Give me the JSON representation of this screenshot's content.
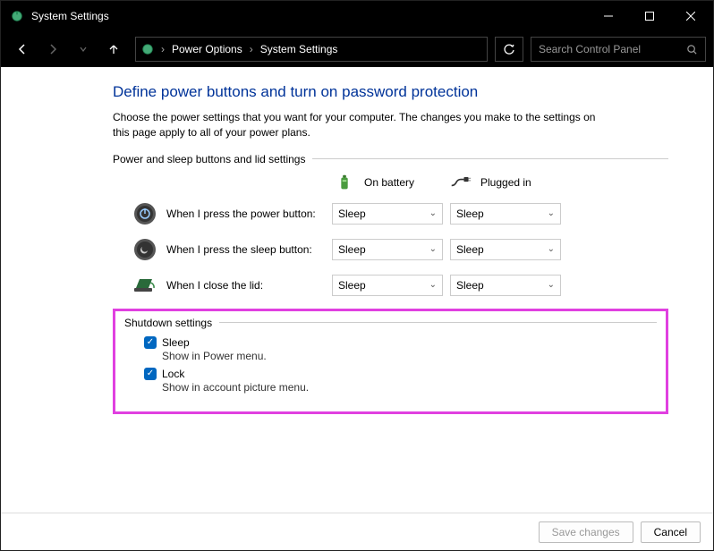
{
  "window": {
    "title": "System Settings"
  },
  "breadcrumb": {
    "item1": "Power Options",
    "item2": "System Settings"
  },
  "search": {
    "placeholder": "Search Control Panel"
  },
  "page": {
    "title": "Define power buttons and turn on password protection",
    "description": "Choose the power settings that you want for your computer. The changes you make to the settings on this page apply to all of your power plans."
  },
  "section1": {
    "heading": "Power and sleep buttons and lid settings",
    "col_battery": "On battery",
    "col_plugged": "Plugged in",
    "rows": [
      {
        "label": "When I press the power button:",
        "battery": "Sleep",
        "plugged": "Sleep"
      },
      {
        "label": "When I press the sleep button:",
        "battery": "Sleep",
        "plugged": "Sleep"
      },
      {
        "label": "When I close the lid:",
        "battery": "Sleep",
        "plugged": "Sleep"
      }
    ]
  },
  "section2": {
    "heading": "Shutdown settings",
    "items": [
      {
        "label": "Sleep",
        "desc": "Show in Power menu."
      },
      {
        "label": "Lock",
        "desc": "Show in account picture menu."
      }
    ]
  },
  "footer": {
    "save": "Save changes",
    "cancel": "Cancel"
  }
}
